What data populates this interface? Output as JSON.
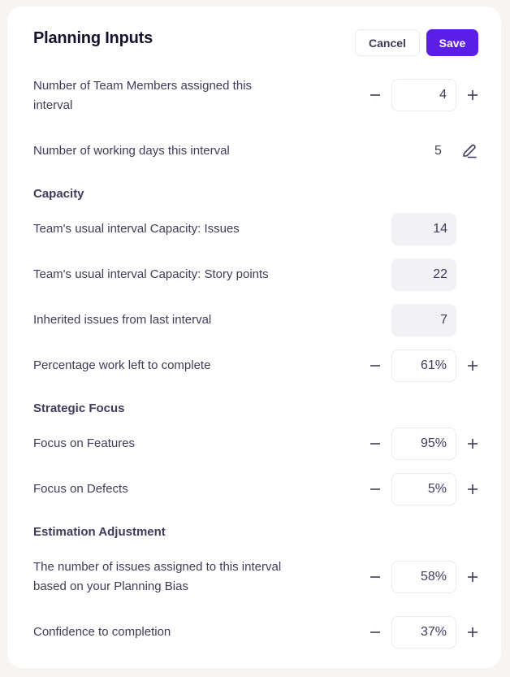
{
  "header": {
    "title": "Planning Inputs",
    "cancel_label": "Cancel",
    "save_label": "Save"
  },
  "colors": {
    "accent": "#5b1ee9",
    "background": "#f7f4f1",
    "readonly_field": "#f2f1f6",
    "text": "#3f3b5a",
    "title": "#14132b"
  },
  "fields": {
    "team_members": {
      "label": "Number of Team Members assigned this interval",
      "value": "4"
    },
    "working_days": {
      "label": "Number of working days this interval",
      "value": "5"
    },
    "capacity_section": "Capacity",
    "capacity_issues": {
      "label": "Team's usual interval Capacity: Issues",
      "value": "14"
    },
    "capacity_points": {
      "label": "Team's usual interval Capacity: Story points",
      "value": "22"
    },
    "inherited_issues": {
      "label": "Inherited issues from last interval",
      "value": "7"
    },
    "work_left": {
      "label": "Percentage work left to complete",
      "value": "61%"
    },
    "strategic_section": "Strategic Focus",
    "focus_features": {
      "label": "Focus on Features",
      "value": "95%"
    },
    "focus_defects": {
      "label": "Focus on Defects",
      "value": "5%"
    },
    "estimation_section": "Estimation Adjustment",
    "planning_bias": {
      "label": "The number of issues assigned to this interval based on your Planning Bias",
      "value": "58%"
    },
    "confidence": {
      "label": "Confidence to completion",
      "value": "37%"
    }
  },
  "icons": {
    "minus": "minus-icon",
    "plus": "plus-icon",
    "edit": "pencil-icon"
  }
}
